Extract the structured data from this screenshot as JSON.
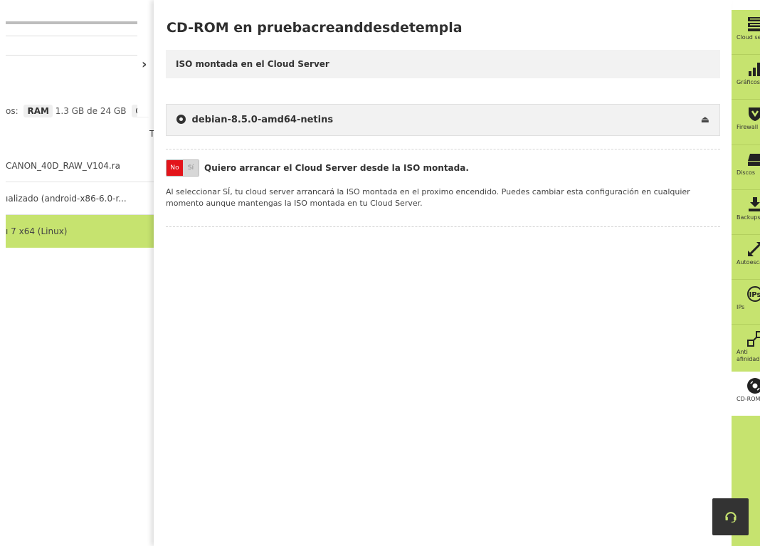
{
  "background": {
    "resources_prefix": "os:",
    "ram_label": "RAM",
    "ram_value": "1.3 GB de 24 GB",
    "extra_pill": "Cc",
    "column_tag": "T",
    "rows": [
      {
        "text": "CANON_40D_RAW_V104.ra",
        "selected": false
      },
      {
        "text": "ıalizado (android-x86-6.0-r...",
        "selected": false
      },
      {
        "text": "ı 7 x64 (Linux)",
        "selected": true
      }
    ]
  },
  "panel": {
    "title": "CD-ROM en pruebacreanddesdetempla",
    "iso_header": "ISO montada en el Cloud Server",
    "iso_name": "debian-8.5.0-amd64-netins",
    "eject_symbol": "⏏",
    "toggle": {
      "no": "No",
      "si": "Sí",
      "selected": "No"
    },
    "boot_label": "Quiero arrancar el Cloud Server desde la ISO montada.",
    "description": "Al seleccionar SÍ, tu cloud server arrancará la ISO montada en el proximo encendido. Puedes cambiar esta configuración en cualquier momento aunque mantengas la ISO montada en tu Cloud Server."
  },
  "sidebar": {
    "items": [
      {
        "label": "Cloud server",
        "icon": "server-icon"
      },
      {
        "label": "Gráficos",
        "icon": "bar-chart-icon"
      },
      {
        "label": "Firewall",
        "icon": "shield-icon"
      },
      {
        "label": "Discos",
        "icon": "disk-icon"
      },
      {
        "label": "Backups",
        "icon": "download-icon"
      },
      {
        "label": "Autoescalado",
        "icon": "resize-icon"
      },
      {
        "label": "IPs",
        "icon": "ip-icon"
      },
      {
        "label": "Anti afinidad",
        "icon": "anti-affinity-icon"
      },
      {
        "label": "CD-ROM",
        "icon": "cd-icon",
        "active": true
      }
    ]
  },
  "colors": {
    "accent_green": "#c6e36f",
    "toggle_red": "#e3141a",
    "help_bg": "#333333"
  }
}
